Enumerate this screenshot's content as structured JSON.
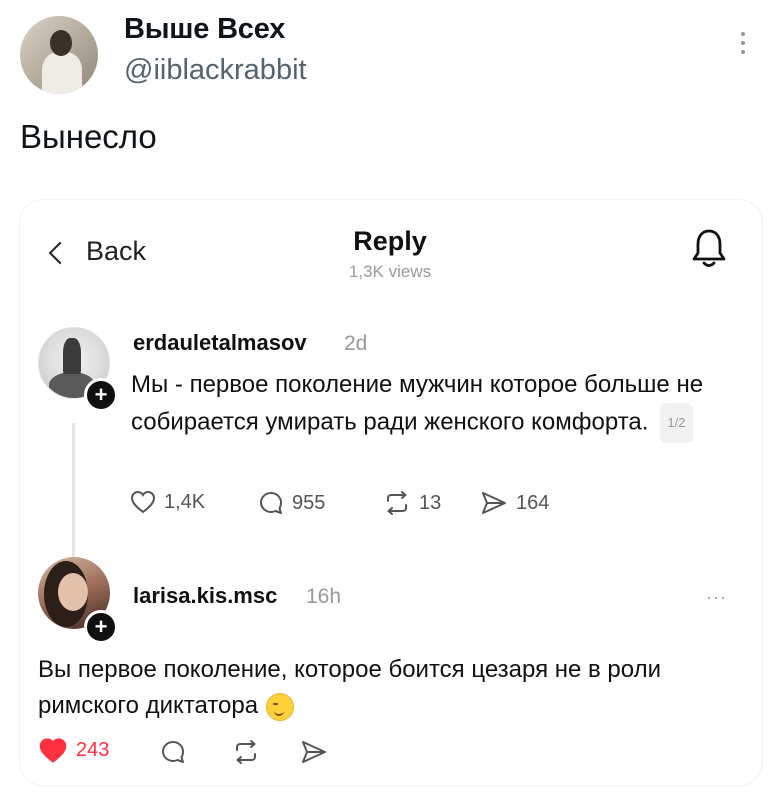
{
  "tweet": {
    "author_name": "Выше Всех",
    "author_handle": "@iiblackrabbit",
    "text": "Вынесло",
    "more_icon": "vertical-dots-icon"
  },
  "screenshot": {
    "back_label": "Back",
    "title": "Reply",
    "views": "1,3K views",
    "bell_icon": "bell-icon",
    "posts": [
      {
        "username": "erdauletalmasov",
        "time": "2d",
        "text": "Мы - первое поколение мужчин которое больше не собирается умирать ради женского комфорта.",
        "pager": "1/2",
        "likes": "1,4K",
        "comments": "955",
        "reposts": "13",
        "shares": "164"
      },
      {
        "username": "larisa.kis.msc",
        "time": "16h",
        "more": "···",
        "text": "Вы первое поколение, которое боится цезаря не в роли римского диктатора",
        "likes": "243",
        "liked": true,
        "like_color": "#ff3040"
      }
    ]
  }
}
